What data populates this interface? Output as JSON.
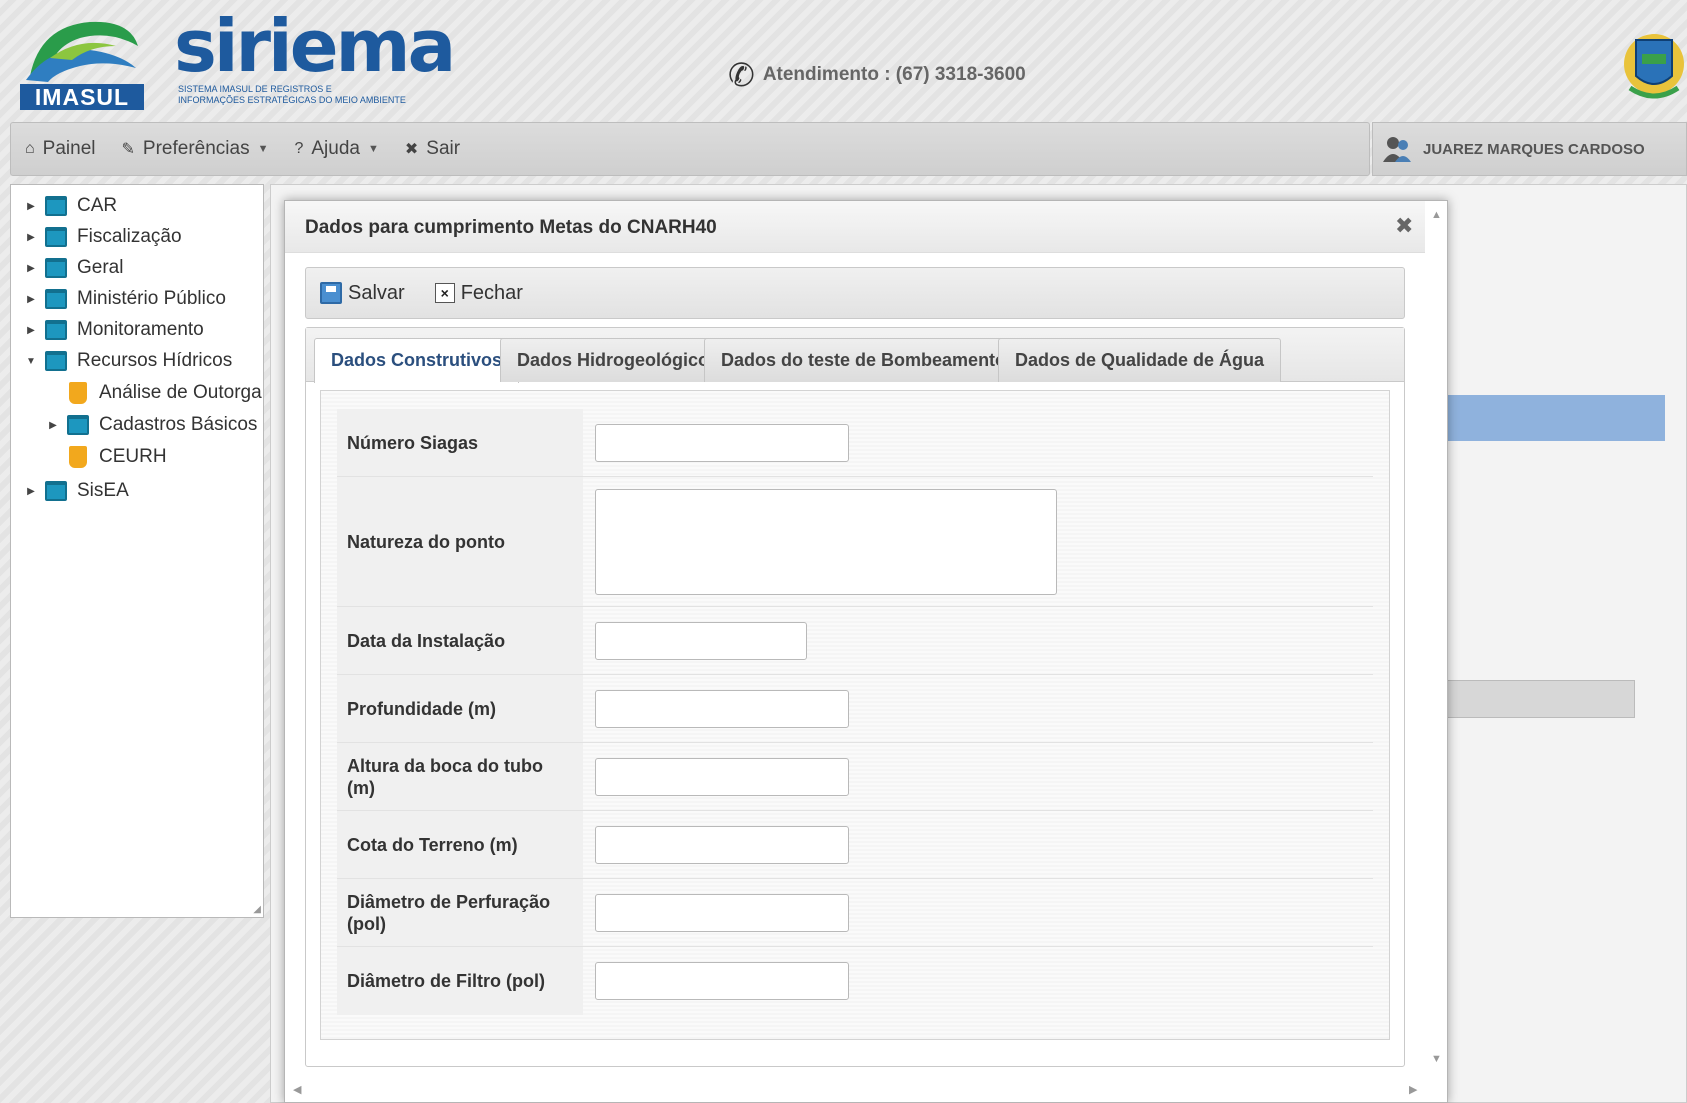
{
  "header": {
    "brand_logo_text": "IMASUL",
    "app_name": "siriema",
    "app_subtitle_line1": "SISTEMA IMASUL DE REGISTROS E",
    "app_subtitle_line2": "INFORMAÇÕES ESTRATÉGICAS DO MEIO AMBIENTE",
    "phone_text": "Atendimento : (67) 3318-3600"
  },
  "menubar": {
    "items": [
      {
        "label": "Painel",
        "icon": "home-icon"
      },
      {
        "label": "Preferências",
        "icon": "pencil-icon"
      },
      {
        "label": "Ajuda",
        "icon": "question-icon"
      },
      {
        "label": "Sair",
        "icon": "close-icon"
      }
    ]
  },
  "user": {
    "name": "JUAREZ MARQUES CARDOSO",
    "icon": "users-icon"
  },
  "sidebar": {
    "items": [
      {
        "label": "CAR",
        "icon": "folder-icon",
        "expanded": false
      },
      {
        "label": "Fiscalização",
        "icon": "folder-icon",
        "expanded": false
      },
      {
        "label": "Geral",
        "icon": "folder-icon",
        "expanded": false
      },
      {
        "label": "Ministério Público",
        "icon": "folder-icon",
        "expanded": false
      },
      {
        "label": "Monitoramento",
        "icon": "folder-icon",
        "expanded": false
      },
      {
        "label": "Recursos Hídricos",
        "icon": "folder-icon",
        "expanded": true
      },
      {
        "label": "Análise de Outorga",
        "icon": "leaf-icon"
      },
      {
        "label": "Cadastros Básicos",
        "icon": "folder-icon",
        "expanded": false
      },
      {
        "label": "CEURH",
        "icon": "leaf-icon"
      },
      {
        "label": "SisEA",
        "icon": "folder-icon",
        "expanded": false
      }
    ]
  },
  "dialog": {
    "title": "Dados para cumprimento Metas do CNARH40",
    "toolbar": {
      "save_label": "Salvar",
      "close_label": "Fechar"
    },
    "tabs": [
      {
        "label": "Dados Construtivos",
        "active": true
      },
      {
        "label": "Dados Hidrogeológico",
        "active": false
      },
      {
        "label": "Dados do teste de Bombeamento",
        "active": false
      },
      {
        "label": "Dados de Qualidade de Água",
        "active": false
      }
    ],
    "fields": [
      {
        "label": "Número Siagas",
        "value": ""
      },
      {
        "label": "Natureza do ponto",
        "value": ""
      },
      {
        "label": "Data da Instalação",
        "value": ""
      },
      {
        "label": "Profundidade (m)",
        "value": ""
      },
      {
        "label": "Altura da boca do tubo (m)",
        "value": ""
      },
      {
        "label": "Cota do Terreno (m)",
        "value": ""
      },
      {
        "label": "Diâmetro de Perfuração (pol)",
        "value": ""
      },
      {
        "label": "Diâmetro de Filtro (pol)",
        "value": ""
      }
    ]
  },
  "colors": {
    "brand_blue": "#1e5a9e",
    "folder_blue": "#1d97bf",
    "tab_active_text": "#2b4f7e"
  }
}
